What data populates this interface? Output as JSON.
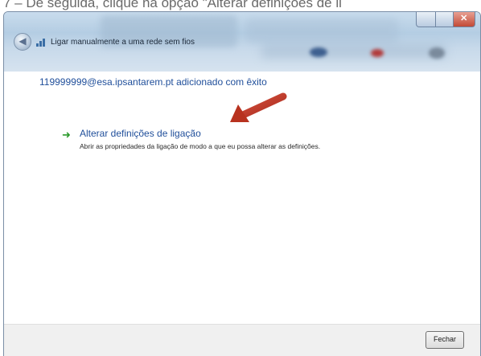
{
  "caption": {
    "text": "7 – De seguida, clique na opção \"Alterar definições de li"
  },
  "window": {
    "title": "Ligar manualmente a uma rede sem fios",
    "close_glyph": "✕",
    "back_glyph": "◀"
  },
  "content": {
    "success_message": "119999999@esa.ipsantarem.pt adicionado com êxito",
    "option": {
      "arrow_glyph": "➜",
      "title": "Alterar definições de ligação",
      "description": "Abrir as propriedades da ligação de modo a que eu possa alterar as definições."
    }
  },
  "footer": {
    "close_label": "Fechar"
  },
  "colors": {
    "link_blue": "#1f4e9a",
    "arrow_green": "#2c9a2c",
    "annotation_red": "#c0392b"
  }
}
